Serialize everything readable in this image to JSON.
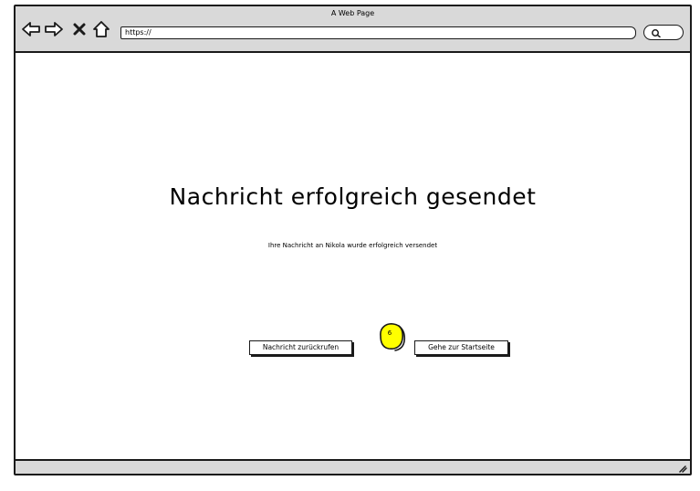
{
  "window": {
    "title": "A Web Page"
  },
  "toolbar": {
    "back_icon": "back-arrow-icon",
    "forward_icon": "forward-arrow-icon",
    "close_icon": "close-x-icon",
    "home_icon": "home-icon",
    "search_icon": "search-icon"
  },
  "address_bar": {
    "value": "https://"
  },
  "main": {
    "headline": "Nachricht erfolgreich gesendet",
    "message": "Ihre Nachricht an Nikola wurde erfolgreich versendet",
    "recall_button_label": "Nachricht zurückrufen",
    "home_button_label": "Gehe zur Startseite",
    "step_marker": "6"
  },
  "colors": {
    "chrome_gray": "#d9d9d9",
    "marker_yellow": "#ffff00",
    "stroke": "#1a1a1a"
  }
}
